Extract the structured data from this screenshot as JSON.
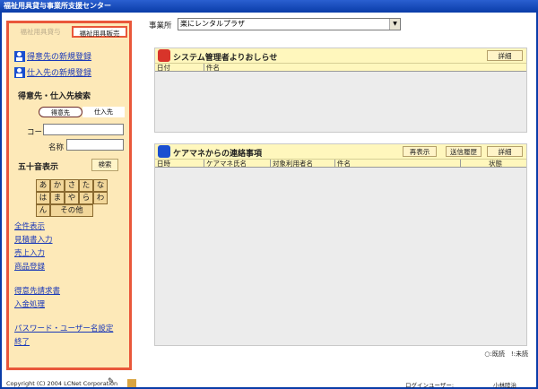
{
  "window": {
    "title": "福祉用具貸与事業所支援センター"
  },
  "sidebar": {
    "tab_inactive": "福祉用具貸与",
    "tab_active": "福祉用具販売",
    "register_customer": "得意先の新規登録",
    "register_supplier": "仕入先の新規登録",
    "search_title": "得意先・仕入先検索",
    "seg_customer": "得意先",
    "seg_supplier": "仕入先",
    "code_label": "コード",
    "name_label": "名称",
    "gojuon_title": "五十音表示",
    "search_button": "検索",
    "kana": [
      "あ",
      "か",
      "さ",
      "た",
      "な",
      "は",
      "ま",
      "や",
      "ら",
      "わ",
      "ん",
      "その他"
    ],
    "menu1": [
      "全件表示",
      "見積書入力",
      "売上入力",
      "商品登録"
    ],
    "menu2": [
      "得意先請求書",
      "入金処理"
    ],
    "menu3": [
      "パスワード・ユーザー名設定",
      "終了"
    ]
  },
  "main": {
    "office_label": "事業所",
    "office_value": "楽にレンタルプラザ"
  },
  "notice_panel": {
    "title": "システム管理者よりおしらせ",
    "detail_button": "詳細",
    "col_date": "日付",
    "col_subject": "件名"
  },
  "contact_panel": {
    "title": "ケアマネからの連絡事項",
    "refresh_button": "再表示",
    "history_button": "送信履歴",
    "detail_button": "詳細",
    "col_datetime": "日時",
    "col_caremanager": "ケアマネ氏名",
    "col_user": "対象利用者名",
    "col_subject": "件名",
    "col_status": "状態"
  },
  "legend": "○:既読　!:未読",
  "footer": {
    "copyright": "Copyright (C) 2004 LCNet Corporation",
    "login_label": "ログインユーザー:",
    "login_user": "小林陸治"
  },
  "colors": {
    "accent": "#e9573a",
    "sidebar_bg": "#fde9b8",
    "panel_head": "#fff7bd",
    "link": "#1a38b8"
  }
}
